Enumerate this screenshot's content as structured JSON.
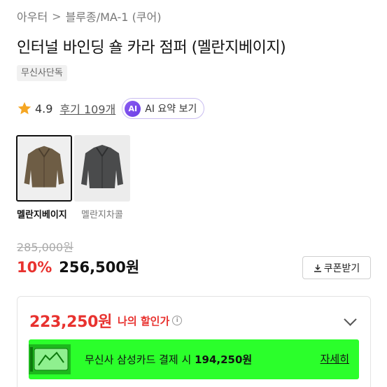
{
  "breadcrumb": {
    "category": "아우터",
    "subcategory": "블루종/MA-1 (쿠어)"
  },
  "product": {
    "title": "인터널 바인딩 숄 카라 점퍼 (멜란지베이지)",
    "exclusive_badge": "무신사단독"
  },
  "rating": {
    "score": "4.9",
    "reviews": "후기 109개"
  },
  "ai_summary": {
    "badge": "AI",
    "label": "AI 요약 보기"
  },
  "colors": [
    {
      "name": "멜란지베이지",
      "selected": true,
      "swatch": "#6e5d45"
    },
    {
      "name": "멜란지차콜",
      "selected": false,
      "swatch": "#4a4b4c"
    }
  ],
  "pricing": {
    "original": "285,000원",
    "discount_rate": "10%",
    "price": "256,500원",
    "coupon_label": "쿠폰받기"
  },
  "my_discount": {
    "amount": "223,250원",
    "label": "나의 할인가",
    "card_text": "무신사 삼성카드 결제 시",
    "card_price": "194,250원",
    "detail_link": "자세히"
  },
  "colors_theme": {
    "accent_red": "#e8322f",
    "banner_green": "#2bff2b",
    "ai_purple": "#7b4ee8",
    "star": "#f5a623"
  }
}
